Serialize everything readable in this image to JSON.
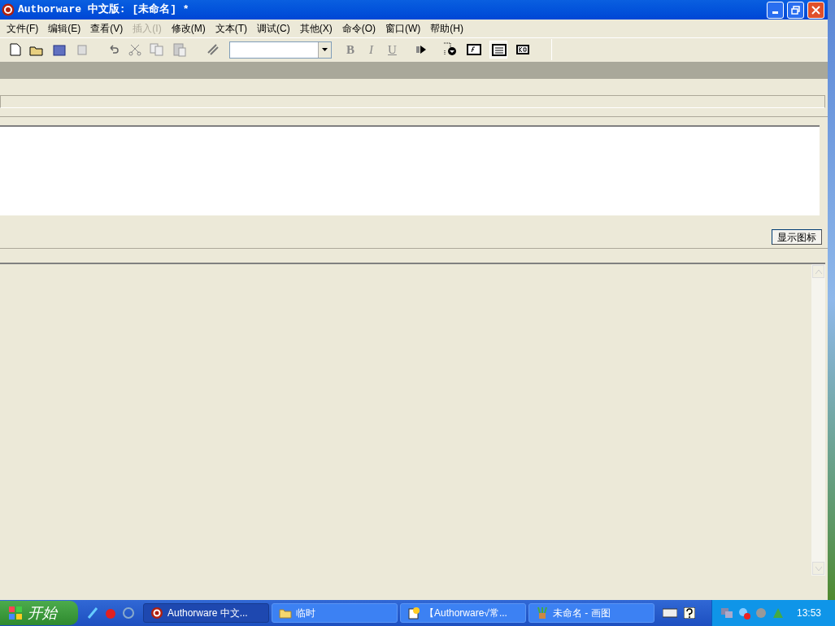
{
  "window": {
    "title": "Authorware 中文版: [未命名] *"
  },
  "menu": [
    {
      "label": "文件(F)",
      "disabled": false
    },
    {
      "label": "编辑(E)",
      "disabled": false
    },
    {
      "label": "查看(V)",
      "disabled": false
    },
    {
      "label": "插入(I)",
      "disabled": true
    },
    {
      "label": "修改(M)",
      "disabled": false
    },
    {
      "label": "文本(T)",
      "disabled": false
    },
    {
      "label": "调试(C)",
      "disabled": false
    },
    {
      "label": "其他(X)",
      "disabled": false
    },
    {
      "label": "命令(O)",
      "disabled": false
    },
    {
      "label": "窗口(W)",
      "disabled": false
    },
    {
      "label": "帮助(H)",
      "disabled": false
    }
  ],
  "toolbar": {
    "bold": "B",
    "italic": "I",
    "underline": "U"
  },
  "panel": {
    "button": "显示图标"
  },
  "taskbar": {
    "start": "开始",
    "tasks": [
      {
        "label": "Authorware 中文...",
        "selected": true,
        "kind": "app"
      },
      {
        "label": "临时",
        "selected": false,
        "kind": "folder"
      },
      {
        "label": "【Authorware√常...",
        "selected": false,
        "kind": "help"
      },
      {
        "label": "未命名 - 画图",
        "selected": false,
        "kind": "paint"
      }
    ],
    "clock": "13:53"
  }
}
